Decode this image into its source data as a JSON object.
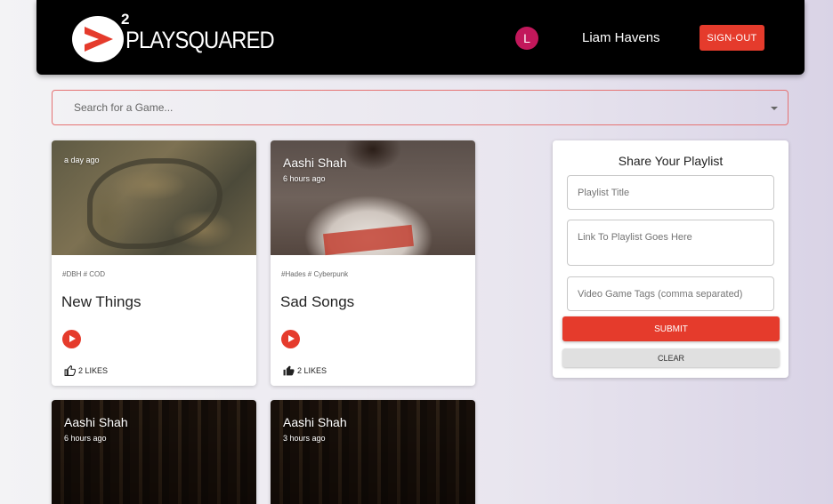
{
  "app": {
    "logo_sup": "2",
    "logo_text": "PLAYSQUARED"
  },
  "user": {
    "avatar_initial": "L",
    "name": "Liam Havens",
    "signout_label": "SIGN-OUT"
  },
  "search": {
    "placeholder": "Search for a Game..."
  },
  "cards": [
    {
      "author": "",
      "time": "a day ago",
      "tags": "#DBH # COD",
      "title": "New Things",
      "likes": "2 LIKES",
      "liked": false,
      "image": "river-aerial"
    },
    {
      "author": "Aashi Shah",
      "time": "6 hours ago",
      "tags": "#Hades # Cyberpunk",
      "title": "Sad Songs",
      "likes": "2 LIKES",
      "liked": true,
      "image": "person-shirt"
    },
    {
      "author": "Aashi Shah",
      "time": "6 hours ago",
      "image": "library"
    },
    {
      "author": "Aashi Shah",
      "time": "3 hours ago",
      "image": "library"
    }
  ],
  "share": {
    "title": "Share Your Playlist",
    "title_placeholder": "Playlist Title",
    "link_placeholder": "Link To Playlist Goes Here",
    "tags_placeholder": "Video Game Tags (comma separated)",
    "submit_label": "SUBMIT",
    "clear_label": "CLEAR"
  },
  "colors": {
    "accent": "#e53b2c",
    "navbar": "#000000",
    "avatar": "#c2185b"
  }
}
